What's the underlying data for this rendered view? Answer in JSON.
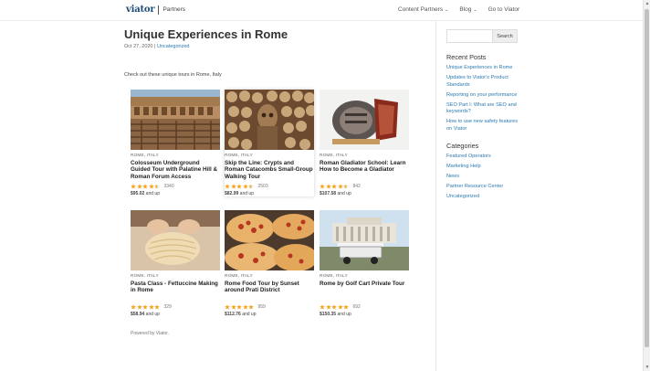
{
  "header": {
    "logo_text": "viator",
    "logo_sub": "Partners",
    "nav": [
      {
        "label": "Content Partners",
        "caret": "⌄"
      },
      {
        "label": "Blog",
        "caret": "⌄"
      },
      {
        "label": "Go to Viator",
        "caret": ""
      }
    ]
  },
  "post": {
    "title": "Unique Experiences in Rome",
    "date": "Oct 27, 2020",
    "sep": " | ",
    "category": "Uncategorized",
    "intro": "Check out these unique tours in Rome, Italy"
  },
  "tours": [
    {
      "location": "ROME, ITALY",
      "title": "Colosseum Underground Guided Tour with Palatine Hill & Roman Forum Access",
      "rating": 4.5,
      "reviews": "3340",
      "price": "$95.02",
      "price_suffix": " and up"
    },
    {
      "location": "ROME, ITALY",
      "title": "Skip the Line: Crypts and Roman Catacombs Small-Group Walking Tour",
      "rating": 4.5,
      "reviews": "2503",
      "price": "$82.99",
      "price_suffix": " and up"
    },
    {
      "location": "ROME, ITALY",
      "title": "Roman Gladiator School: Learn How to Become a Gladiator",
      "rating": 4.5,
      "reviews": "842",
      "price": "$107.58",
      "price_suffix": " and up"
    },
    {
      "location": "ROME, ITALY",
      "title": "Pasta Class - Fettuccine Making in Rome",
      "rating": 5,
      "reviews": "329",
      "price": "$58.94",
      "price_suffix": " and up"
    },
    {
      "location": "ROME, ITALY",
      "title": "Rome Food Tour by Sunset around Prati District",
      "rating": 5,
      "reviews": "959",
      "price": "$112.76",
      "price_suffix": " and up"
    },
    {
      "location": "ROME, ITALY",
      "title": "Rome by Golf Cart Private Tour",
      "rating": 5,
      "reviews": "692",
      "price": "$150.35",
      "price_suffix": " and up"
    }
  ],
  "powered": "Powered by Viator.",
  "sidebar": {
    "search_placeholder": "",
    "search_button": "Search",
    "recent_heading": "Recent Posts",
    "recent": [
      "Unique Experiences in Rome",
      "Updates to Viator's Product Standards",
      "Reporting on your performance",
      "SEO Part I: What are SEO and keywords?",
      "How to use new safety features on Viator"
    ],
    "categories_heading": "Categories",
    "categories": [
      "Featured Operators",
      "Marketing Help",
      "News",
      "Partner Resource Center",
      "Uncategorized"
    ]
  },
  "colors": {
    "link": "#2a7ab0",
    "star": "#f5a623",
    "logo": "#1f4e79"
  }
}
